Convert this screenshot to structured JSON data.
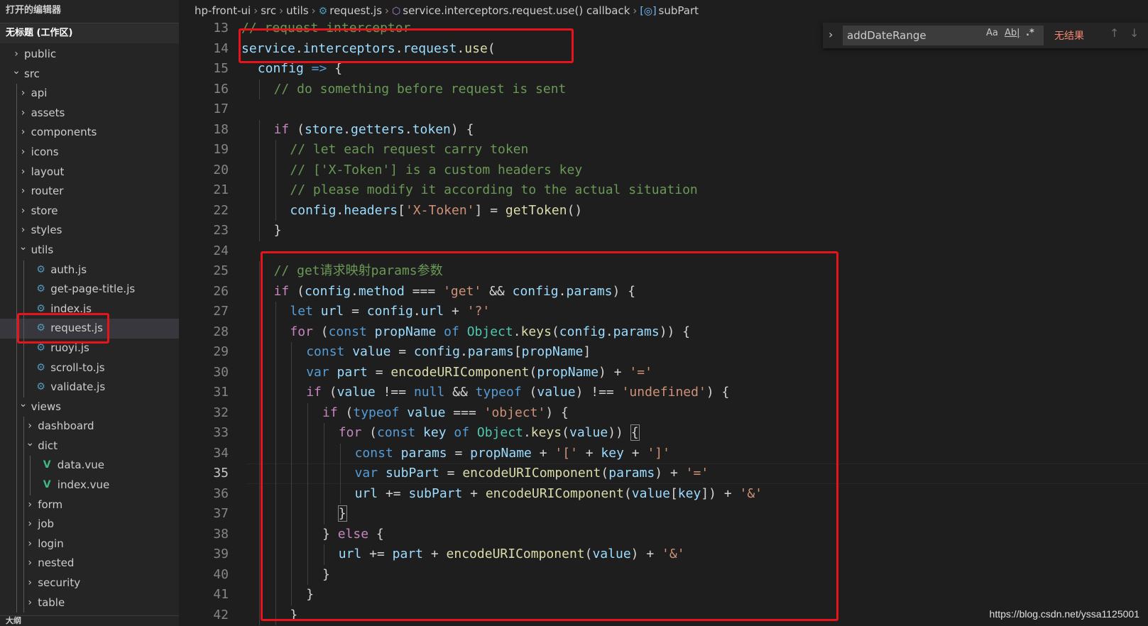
{
  "sidebar": {
    "open_editors_label": "打开的编辑器",
    "workspace_label": "无标题 (工作区)",
    "items": [
      {
        "label": "public",
        "type": "folder",
        "expanded": false,
        "depth": 0
      },
      {
        "label": "src",
        "type": "folder",
        "expanded": true,
        "depth": 0
      },
      {
        "label": "api",
        "type": "folder",
        "expanded": false,
        "depth": 1
      },
      {
        "label": "assets",
        "type": "folder",
        "expanded": false,
        "depth": 1
      },
      {
        "label": "components",
        "type": "folder",
        "expanded": false,
        "depth": 1
      },
      {
        "label": "icons",
        "type": "folder",
        "expanded": false,
        "depth": 1
      },
      {
        "label": "layout",
        "type": "folder",
        "expanded": false,
        "depth": 1
      },
      {
        "label": "router",
        "type": "folder",
        "expanded": false,
        "depth": 1
      },
      {
        "label": "store",
        "type": "folder",
        "expanded": false,
        "depth": 1
      },
      {
        "label": "styles",
        "type": "folder",
        "expanded": false,
        "depth": 1
      },
      {
        "label": "utils",
        "type": "folder",
        "expanded": true,
        "depth": 1
      },
      {
        "label": "auth.js",
        "type": "js",
        "depth": 2
      },
      {
        "label": "get-page-title.js",
        "type": "js",
        "depth": 2
      },
      {
        "label": "index.js",
        "type": "js",
        "depth": 2
      },
      {
        "label": "request.js",
        "type": "js",
        "depth": 2,
        "selected": true
      },
      {
        "label": "ruoyi.js",
        "type": "js",
        "depth": 2
      },
      {
        "label": "scroll-to.js",
        "type": "js",
        "depth": 2
      },
      {
        "label": "validate.js",
        "type": "js",
        "depth": 2
      },
      {
        "label": "views",
        "type": "folder",
        "expanded": true,
        "depth": 1
      },
      {
        "label": "dashboard",
        "type": "folder",
        "expanded": false,
        "depth": 2
      },
      {
        "label": "dict",
        "type": "folder",
        "expanded": true,
        "depth": 2
      },
      {
        "label": "data.vue",
        "type": "vue",
        "depth": 3
      },
      {
        "label": "index.vue",
        "type": "vue",
        "depth": 3
      },
      {
        "label": "form",
        "type": "folder",
        "expanded": false,
        "depth": 2
      },
      {
        "label": "job",
        "type": "folder",
        "expanded": false,
        "depth": 2
      },
      {
        "label": "login",
        "type": "folder",
        "expanded": false,
        "depth": 2
      },
      {
        "label": "nested",
        "type": "folder",
        "expanded": false,
        "depth": 2
      },
      {
        "label": "security",
        "type": "folder",
        "expanded": false,
        "depth": 2
      },
      {
        "label": "table",
        "type": "folder",
        "expanded": false,
        "depth": 2
      }
    ],
    "footer_label": "大纲"
  },
  "breadcrumb": {
    "items": [
      "hp-front-ui",
      "src",
      "utils",
      "request.js",
      "service.interceptors.request.use() callback",
      "subPart"
    ],
    "icons": [
      "",
      "",
      "",
      "js-file-icon",
      "method-icon",
      "variable-icon"
    ]
  },
  "find_widget": {
    "query": "addDateRange",
    "match_case": "Aa",
    "whole_word": "Ab|",
    "regex": ".*",
    "result": "无结果"
  },
  "editor": {
    "active_line": 35,
    "lines": [
      {
        "n": 13,
        "indent": 0,
        "tokens": [
          [
            "cmt",
            "// request interceptor"
          ]
        ]
      },
      {
        "n": 14,
        "indent": 0,
        "tokens": [
          [
            "var",
            "service"
          ],
          [
            "pn",
            "."
          ],
          [
            "var",
            "interceptors"
          ],
          [
            "pn",
            "."
          ],
          [
            "var",
            "request"
          ],
          [
            "pn",
            "."
          ],
          [
            "fn",
            "use"
          ],
          [
            "pn",
            "("
          ]
        ]
      },
      {
        "n": 15,
        "indent": 1,
        "tokens": [
          [
            "var",
            "config"
          ],
          [
            "pn",
            " "
          ],
          [
            "kw",
            "=>"
          ],
          [
            "pn",
            " {"
          ]
        ]
      },
      {
        "n": 16,
        "indent": 2,
        "tokens": [
          [
            "cmt",
            "// do something before request is sent"
          ]
        ]
      },
      {
        "n": 17,
        "indent": 0,
        "tokens": []
      },
      {
        "n": 18,
        "indent": 2,
        "tokens": [
          [
            "ctl",
            "if"
          ],
          [
            "pn",
            " ("
          ],
          [
            "var",
            "store"
          ],
          [
            "pn",
            "."
          ],
          [
            "var",
            "getters"
          ],
          [
            "pn",
            "."
          ],
          [
            "var",
            "token"
          ],
          [
            "pn",
            ") {"
          ]
        ]
      },
      {
        "n": 19,
        "indent": 3,
        "tokens": [
          [
            "cmt",
            "// let each request carry token"
          ]
        ]
      },
      {
        "n": 20,
        "indent": 3,
        "tokens": [
          [
            "cmt",
            "// ['X-Token'] is a custom headers key"
          ]
        ]
      },
      {
        "n": 21,
        "indent": 3,
        "tokens": [
          [
            "cmt",
            "// please modify it according to the actual situation"
          ]
        ]
      },
      {
        "n": 22,
        "indent": 3,
        "tokens": [
          [
            "var",
            "config"
          ],
          [
            "pn",
            "."
          ],
          [
            "var",
            "headers"
          ],
          [
            "pn",
            "["
          ],
          [
            "str",
            "'X-Token'"
          ],
          [
            "pn",
            "] = "
          ],
          [
            "fn",
            "getToken"
          ],
          [
            "pn",
            "()"
          ]
        ]
      },
      {
        "n": 23,
        "indent": 2,
        "tokens": [
          [
            "pn",
            "}"
          ]
        ]
      },
      {
        "n": 24,
        "indent": 0,
        "tokens": []
      },
      {
        "n": 25,
        "indent": 2,
        "tokens": [
          [
            "cmt",
            "// get请求映射params参数"
          ]
        ]
      },
      {
        "n": 26,
        "indent": 2,
        "tokens": [
          [
            "ctl",
            "if"
          ],
          [
            "pn",
            " ("
          ],
          [
            "var",
            "config"
          ],
          [
            "pn",
            "."
          ],
          [
            "var",
            "method"
          ],
          [
            "pn",
            " === "
          ],
          [
            "str",
            "'get'"
          ],
          [
            "pn",
            " && "
          ],
          [
            "var",
            "config"
          ],
          [
            "pn",
            "."
          ],
          [
            "var",
            "params"
          ],
          [
            "pn",
            ") {"
          ]
        ]
      },
      {
        "n": 27,
        "indent": 3,
        "tokens": [
          [
            "kw",
            "let"
          ],
          [
            "pn",
            " "
          ],
          [
            "var",
            "url"
          ],
          [
            "pn",
            " = "
          ],
          [
            "var",
            "config"
          ],
          [
            "pn",
            "."
          ],
          [
            "var",
            "url"
          ],
          [
            "pn",
            " + "
          ],
          [
            "str",
            "'?'"
          ]
        ]
      },
      {
        "n": 28,
        "indent": 3,
        "tokens": [
          [
            "ctl",
            "for"
          ],
          [
            "pn",
            " ("
          ],
          [
            "kw",
            "const"
          ],
          [
            "pn",
            " "
          ],
          [
            "var",
            "propName"
          ],
          [
            "pn",
            " "
          ],
          [
            "kw",
            "of"
          ],
          [
            "pn",
            " "
          ],
          [
            "cls",
            "Object"
          ],
          [
            "pn",
            "."
          ],
          [
            "fn",
            "keys"
          ],
          [
            "pn",
            "("
          ],
          [
            "var",
            "config"
          ],
          [
            "pn",
            "."
          ],
          [
            "var",
            "params"
          ],
          [
            "pn",
            ")) {"
          ]
        ]
      },
      {
        "n": 29,
        "indent": 4,
        "tokens": [
          [
            "kw",
            "const"
          ],
          [
            "pn",
            " "
          ],
          [
            "var",
            "value"
          ],
          [
            "pn",
            " = "
          ],
          [
            "var",
            "config"
          ],
          [
            "pn",
            "."
          ],
          [
            "var",
            "params"
          ],
          [
            "pn",
            "["
          ],
          [
            "var",
            "propName"
          ],
          [
            "pn",
            "]"
          ]
        ]
      },
      {
        "n": 30,
        "indent": 4,
        "tokens": [
          [
            "kw",
            "var"
          ],
          [
            "pn",
            " "
          ],
          [
            "var",
            "part"
          ],
          [
            "pn",
            " = "
          ],
          [
            "fn",
            "encodeURIComponent"
          ],
          [
            "pn",
            "("
          ],
          [
            "var",
            "propName"
          ],
          [
            "pn",
            ") + "
          ],
          [
            "str",
            "'='"
          ]
        ]
      },
      {
        "n": 31,
        "indent": 4,
        "tokens": [
          [
            "ctl",
            "if"
          ],
          [
            "pn",
            " ("
          ],
          [
            "var",
            "value"
          ],
          [
            "pn",
            " !== "
          ],
          [
            "kw",
            "null"
          ],
          [
            "pn",
            " && "
          ],
          [
            "kw",
            "typeof"
          ],
          [
            "pn",
            " ("
          ],
          [
            "var",
            "value"
          ],
          [
            "pn",
            ") !== "
          ],
          [
            "str",
            "'undefined'"
          ],
          [
            "pn",
            ") {"
          ]
        ]
      },
      {
        "n": 32,
        "indent": 5,
        "tokens": [
          [
            "ctl",
            "if"
          ],
          [
            "pn",
            " ("
          ],
          [
            "kw",
            "typeof"
          ],
          [
            "pn",
            " "
          ],
          [
            "var",
            "value"
          ],
          [
            "pn",
            " === "
          ],
          [
            "str",
            "'object'"
          ],
          [
            "pn",
            ") {"
          ]
        ]
      },
      {
        "n": 33,
        "indent": 6,
        "tokens": [
          [
            "ctl",
            "for"
          ],
          [
            "pn",
            " ("
          ],
          [
            "kw",
            "const"
          ],
          [
            "pn",
            " "
          ],
          [
            "var",
            "key"
          ],
          [
            "pn",
            " "
          ],
          [
            "kw",
            "of"
          ],
          [
            "pn",
            " "
          ],
          [
            "cls",
            "Object"
          ],
          [
            "pn",
            "."
          ],
          [
            "fn",
            "keys"
          ],
          [
            "pn",
            "("
          ],
          [
            "var",
            "value"
          ],
          [
            "pn",
            ")) "
          ],
          [
            "brk",
            "{"
          ]
        ]
      },
      {
        "n": 34,
        "indent": 7,
        "tokens": [
          [
            "kw",
            "const"
          ],
          [
            "pn",
            " "
          ],
          [
            "var",
            "params"
          ],
          [
            "pn",
            " = "
          ],
          [
            "var",
            "propName"
          ],
          [
            "pn",
            " + "
          ],
          [
            "str",
            "'['"
          ],
          [
            "pn",
            " + "
          ],
          [
            "var",
            "key"
          ],
          [
            "pn",
            " + "
          ],
          [
            "str",
            "']'"
          ]
        ]
      },
      {
        "n": 35,
        "indent": 7,
        "tokens": [
          [
            "kw",
            "var"
          ],
          [
            "pn",
            " "
          ],
          [
            "var",
            "subPart"
          ],
          [
            "pn",
            " = "
          ],
          [
            "fn",
            "encodeURIComponent"
          ],
          [
            "pn",
            "("
          ],
          [
            "var",
            "params"
          ],
          [
            "pn",
            ") + "
          ],
          [
            "str",
            "'='"
          ]
        ]
      },
      {
        "n": 36,
        "indent": 7,
        "tokens": [
          [
            "var",
            "url"
          ],
          [
            "pn",
            " += "
          ],
          [
            "var",
            "subPart"
          ],
          [
            "pn",
            " + "
          ],
          [
            "fn",
            "encodeURIComponent"
          ],
          [
            "pn",
            "("
          ],
          [
            "var",
            "value"
          ],
          [
            "pn",
            "["
          ],
          [
            "var",
            "key"
          ],
          [
            "pn",
            "]) + "
          ],
          [
            "str",
            "'&'"
          ]
        ]
      },
      {
        "n": 37,
        "indent": 6,
        "tokens": [
          [
            "brk",
            "}"
          ]
        ]
      },
      {
        "n": 38,
        "indent": 5,
        "tokens": [
          [
            "pn",
            "} "
          ],
          [
            "ctl",
            "else"
          ],
          [
            "pn",
            " {"
          ]
        ]
      },
      {
        "n": 39,
        "indent": 6,
        "tokens": [
          [
            "var",
            "url"
          ],
          [
            "pn",
            " += "
          ],
          [
            "var",
            "part"
          ],
          [
            "pn",
            " + "
          ],
          [
            "fn",
            "encodeURIComponent"
          ],
          [
            "pn",
            "("
          ],
          [
            "var",
            "value"
          ],
          [
            "pn",
            ") + "
          ],
          [
            "str",
            "'&'"
          ]
        ]
      },
      {
        "n": 40,
        "indent": 5,
        "tokens": [
          [
            "pn",
            "}"
          ]
        ]
      },
      {
        "n": 41,
        "indent": 4,
        "tokens": [
          [
            "pn",
            "}"
          ]
        ]
      },
      {
        "n": 42,
        "indent": 3,
        "tokens": [
          [
            "pn",
            "}"
          ]
        ]
      }
    ]
  },
  "colors": {
    "highlight_box": "#e8141b",
    "comment": "#6a9955",
    "keyword": "#569cd6",
    "control": "#c586c0",
    "variable": "#9cdcfe",
    "function": "#dcdcaa",
    "string": "#ce9178",
    "class": "#4ec9b0"
  },
  "watermark": "https://blog.csdn.net/yssa1125001"
}
